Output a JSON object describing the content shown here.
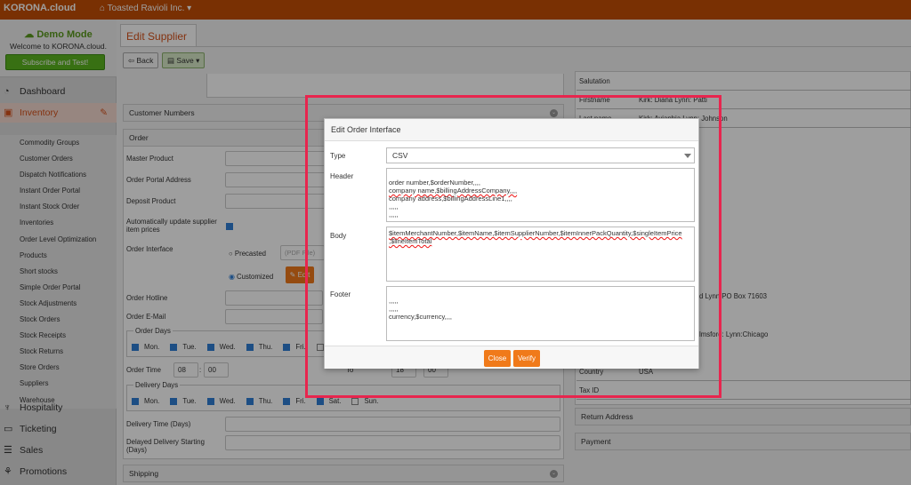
{
  "topbar": {
    "logo": "KORONA.cloud",
    "company": "Toasted Ravioli Inc. ▾"
  },
  "demo": {
    "title": "Demo Mode",
    "welcome": "Welcome to KORONA.cloud.",
    "button": "Subscribe and Test!"
  },
  "nav": {
    "dashboard": "Dashboard",
    "inventory": "Inventory",
    "hospitality": "Hospitality",
    "ticketing": "Ticketing",
    "sales": "Sales",
    "promotions": "Promotions"
  },
  "subnav": [
    "Commodity Groups",
    "Customer Orders",
    "Dispatch Notifications",
    "Instant Order Portal",
    "Instant Stock Order",
    "Inventories",
    "Order Level Optimization",
    "Products",
    "Short stocks",
    "Simple Order Portal",
    "Stock Adjustments",
    "Stock Orders",
    "Stock Receipts",
    "Stock Returns",
    "Store Orders",
    "Suppliers",
    "Warehouse"
  ],
  "page": {
    "tab": "Edit Supplier",
    "back": "Back",
    "save": "Save ▾"
  },
  "form": {
    "customer_numbers": "Customer Numbers",
    "order": "Order",
    "master_product": "Master Product",
    "order_portal_address": "Order Portal Address",
    "deposit_product": "Deposit Product",
    "auto_update": "Automatically update supplier item prices",
    "order_interface": "Order Interface",
    "precasted": "Precasted",
    "pdf_placeholder": "(PDF File)",
    "customized": "Customized",
    "edit": "Edit",
    "order_hotline": "Order Hotline",
    "order_email": "Order E-Mail",
    "order_days": "Order Days",
    "days": [
      "Mon.",
      "Tue.",
      "Wed.",
      "Thu.",
      "Fri.",
      "Sat.",
      "Sun."
    ],
    "order_time": "Order Time",
    "hour": "08",
    "minute": "00",
    "time_sep": ":",
    "to": "To",
    "to_hour": "18",
    "to_minute": "00",
    "delivery_days": "Delivery Days",
    "delivery_time": "Delivery Time (Days)",
    "delayed_delivery": "Delayed Delivery Starting (Days)",
    "shipping": "Shipping"
  },
  "right": {
    "salutation": "Salutation",
    "firstname": "Firstname",
    "firstname_val": "Kirk: Diana Lynn: Patti",
    "lastname": "Last name",
    "lastname_val": "Kirk: Aviaphia Lynn: Johnson",
    "address_val": "d Lynn:PO Box 71603",
    "city_val": "lmsford: Lynn:Chicago",
    "country": "Country",
    "country_val": "USA",
    "taxid": "Tax ID",
    "return_address": "Return Address",
    "payment": "Payment"
  },
  "modal": {
    "title": "Edit Order Interface",
    "type_label": "Type",
    "type_value": "CSV",
    "header_label": "Header",
    "body_label": "Body",
    "footer_label": "Footer",
    "header_lines": [
      "order number,$orderNumber,,,,",
      "company name,$billingAddressCompany,,,,",
      "company address,$billingAddressLine1,,,,",
      ",,,,,",
      ",,,,,",
      ",,,,,"
    ],
    "body_text": "$itemMerchantNumber,$itemName,$itemSupplierNumber,$itemInnerPackQuantity,$singleItemPrice",
    "body_text2": ",$lineItemTotal",
    "footer_lines": [
      ",,,,,",
      ",,,,,",
      "currency,$currency,,,,"
    ],
    "close": "Close",
    "verify": "Verify"
  }
}
